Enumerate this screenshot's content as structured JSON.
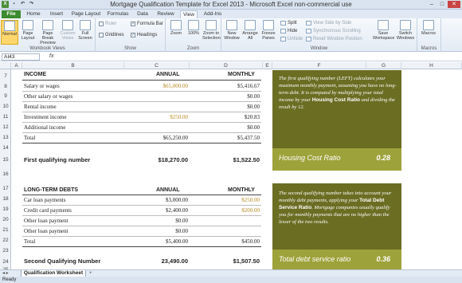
{
  "window": {
    "title": "Mortgage Qualification Template for Excel 2013 - Microsoft Excel non-commercial use"
  },
  "tabs": [
    "File",
    "Home",
    "Insert",
    "Page Layout",
    "Formulas",
    "Data",
    "Review",
    "View",
    "Add-Ins"
  ],
  "ribbon": {
    "workbook_views": {
      "label": "Workbook Views",
      "buttons": [
        "Normal",
        "Page Layout",
        "Page Break Preview",
        "Custom Views",
        "Full Screen"
      ]
    },
    "show": {
      "label": "Show",
      "ruler": "Ruler",
      "gridlines": "Gridlines",
      "formula_bar": "Formula Bar",
      "headings": "Headings"
    },
    "zoom": {
      "label": "Zoom",
      "buttons": [
        "Zoom",
        "100%",
        "Zoom to Selection"
      ]
    },
    "window": {
      "label": "Window",
      "buttons": [
        "New Window",
        "Arrange All",
        "Freeze Panes"
      ],
      "split": "Split",
      "hide": "Hide",
      "unhide": "Unhide",
      "side_by_side": "View Side by Side",
      "sync_scroll": "Synchronous Scrolling",
      "reset_pos": "Reset Window Position",
      "save_ws": "Save Workspace",
      "switch": "Switch Windows"
    },
    "macros": {
      "label": "Macros",
      "button": "Macros"
    }
  },
  "formula_bar": {
    "name_box": "AI43",
    "fx": "fx"
  },
  "columns": [
    "A",
    "B",
    "C",
    "D",
    "E",
    "F",
    "G",
    "H"
  ],
  "rows": [
    "7",
    "8",
    "9",
    "10",
    "11",
    "12",
    "13",
    "14",
    "15",
    "16",
    "17",
    "18",
    "19",
    "20",
    "21",
    "22",
    "23",
    "24",
    "25"
  ],
  "income": {
    "header": "INCOME",
    "col_annual": "ANNUAL",
    "col_monthly": "MONTHLY",
    "items": [
      {
        "label": "Salary or wages",
        "annual": "$65,000.00",
        "monthly": "$5,416.67"
      },
      {
        "label": "Other salary or wages",
        "annual": "",
        "monthly": "$0.00"
      },
      {
        "label": "Rental income",
        "annual": "",
        "monthly": "$0.00"
      },
      {
        "label": "Investment income",
        "annual": "$250.00",
        "monthly": "$20.83"
      },
      {
        "label": "Additional income",
        "annual": "",
        "monthly": "$0.00"
      }
    ],
    "total_label": "Total",
    "total_annual": "$65,250.00",
    "total_monthly": "$5,437.50",
    "qualifying_label": "First qualifying number",
    "qualifying_annual": "$18,270.00",
    "qualifying_monthly": "$1,522.50"
  },
  "debts": {
    "header": "LONG-TERM DEBTS",
    "col_annual": "ANNUAL",
    "col_monthly": "MONTHLY",
    "items": [
      {
        "label": "Car loan payments",
        "annual": "$3,000.00",
        "monthly": "$250.00"
      },
      {
        "label": "Credit card payments",
        "annual": "$2,400.00",
        "monthly": "$200.00"
      },
      {
        "label": "Other loan payment",
        "annual": "$0.00",
        "monthly": ""
      },
      {
        "label": "Other loan payment",
        "annual": "$0.00",
        "monthly": ""
      }
    ],
    "total_label": "Total",
    "total_annual": "$5,400.00",
    "total_monthly": "$450.00",
    "qualifying_label": "Second Qualifying Number",
    "qualifying_annual": "23,490.00",
    "qualifying_monthly": "$1,507.50"
  },
  "panel1": {
    "text_a": "The first qualifying number (LEFT) calculates your maximum monthly payment, assuming you have no long-term debt. It is computed by multiplying your total income by your ",
    "bold": "Housing Cost Ratio",
    "text_b": " and dividing the result by 12.",
    "ratio_label": "Housing Cost Ratio",
    "ratio_value": "0.28"
  },
  "panel2": {
    "text_a": "The second qualifying number takes into account your monthly debt payments, applying your ",
    "bold": "Total Debt Service Ratio",
    "text_b": ". Mortgage companies usually qualify you for monthly payments that are no higher than the lesser of the two results.",
    "ratio_label": "Total debt service ratio",
    "ratio_value": "0.36"
  },
  "sheet_tab": "Qualification Worksheet",
  "status": "Ready"
}
